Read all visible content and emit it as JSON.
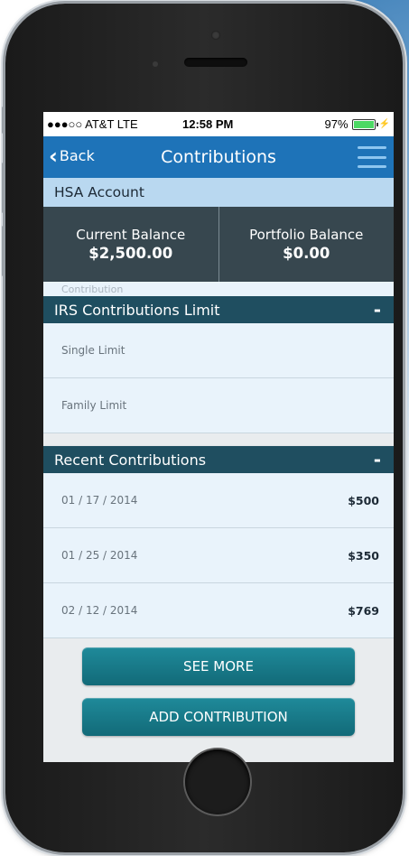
{
  "status_bar": {
    "carrier": "●●●○○ AT&T  LTE",
    "time": "12:58 PM",
    "battery": "97%",
    "charging": "⚡"
  },
  "nav": {
    "back_label": "Back",
    "title": "Contributions"
  },
  "account": {
    "name": "HSA Account"
  },
  "balances": {
    "current_label": "Current Balance",
    "current_value": "$2,500.00",
    "portfolio_label": "Portfolio Balance",
    "portfolio_value": "$0.00"
  },
  "peek_text": "Contribution",
  "irs_section": {
    "title": "IRS Contributions Limit",
    "collapse": "-",
    "rows": [
      {
        "label": "Single Limit"
      },
      {
        "label": "Family Limit"
      }
    ]
  },
  "recent_section": {
    "title": "Recent Contributions",
    "collapse": "-",
    "rows": [
      {
        "date": "01 / 17 / 2014",
        "amount": "$500"
      },
      {
        "date": "01 / 25 / 2014",
        "amount": "$350"
      },
      {
        "date": "02 / 12 / 2014",
        "amount": "$769"
      }
    ]
  },
  "buttons": {
    "see_more": "SEE MORE",
    "add_contribution": "ADD CONTRIBUTION"
  },
  "colors": {
    "nav_blue": "#1e73b8",
    "section_header": "#1f4e60",
    "button_teal": "#1f8a9a",
    "balance_panel": "#37474f"
  }
}
